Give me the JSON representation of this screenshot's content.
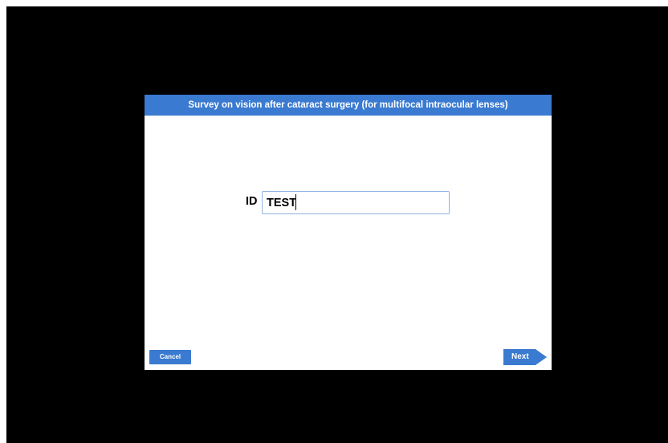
{
  "survey": {
    "title": "Survey on vision after cataract surgery (for multifocal intraocular lenses)",
    "id_label": "ID",
    "id_value": "TEST"
  },
  "buttons": {
    "cancel_label": "Cancel",
    "next_label": "Next"
  },
  "colors": {
    "screen_background": "#000000",
    "panel_background": "#ffffff",
    "accent": "#3a7ad0",
    "input_border": "#8fb2e0"
  }
}
